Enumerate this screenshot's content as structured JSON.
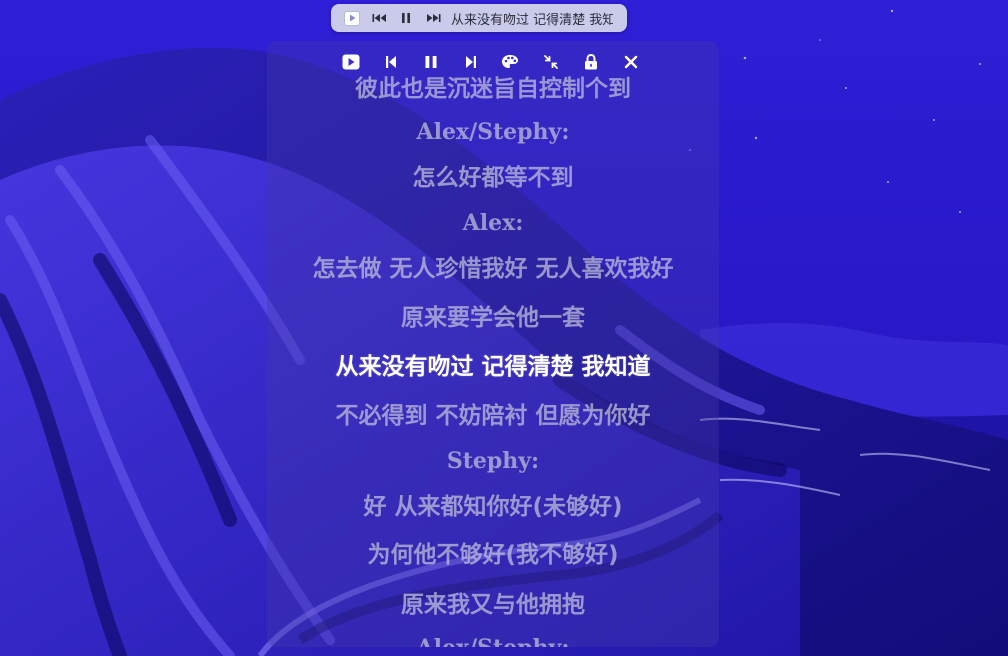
{
  "mini_player": {
    "icons": [
      "play-icon",
      "previous-icon",
      "pause-icon",
      "next-icon"
    ],
    "now_playing": "从来没有吻过 记得清楚 我知道"
  },
  "toolbar": {
    "icons": [
      "play-icon",
      "previous-icon",
      "pause-icon",
      "next-icon",
      "palette-icon",
      "collapse-icon",
      "lock-icon",
      "close-icon"
    ]
  },
  "lyrics": {
    "lines": [
      {
        "text": "彼此也是沉迷旨自控制个到",
        "kind": "lyric",
        "state": "past"
      },
      {
        "text": "Alex/Stephy:",
        "kind": "singer",
        "state": "past"
      },
      {
        "text": "怎么好都等不到",
        "kind": "lyric",
        "state": "past"
      },
      {
        "text": "Alex:",
        "kind": "singer",
        "state": "past"
      },
      {
        "text": "怎去做 无人珍惜我好 无人喜欢我好",
        "kind": "lyric",
        "state": "past"
      },
      {
        "text": "原来要学会他一套",
        "kind": "lyric",
        "state": "past"
      },
      {
        "text": "从来没有吻过 记得清楚 我知道",
        "kind": "lyric",
        "state": "current"
      },
      {
        "text": "不必得到 不妨陪衬 但愿为你好",
        "kind": "lyric",
        "state": "upcoming"
      },
      {
        "text": "Stephy:",
        "kind": "singer",
        "state": "upcoming"
      },
      {
        "text": "好 从来都知你好(未够好)",
        "kind": "lyric",
        "state": "upcoming"
      },
      {
        "text": "为何他不够好(我不够好)",
        "kind": "lyric",
        "state": "upcoming"
      },
      {
        "text": "原来我又与他拥抱",
        "kind": "lyric",
        "state": "upcoming"
      },
      {
        "text": "Alex/Stephy:",
        "kind": "singer",
        "state": "upcoming"
      }
    ]
  },
  "colors": {
    "sky": "#2a1bd0",
    "mountain_dark": "#0d0a6e",
    "mountain_mid": "#2e1fc4",
    "mountain_light": "#5a4df0",
    "current_lyric": "#ffffff",
    "other_lyric": "#c4c4de"
  }
}
